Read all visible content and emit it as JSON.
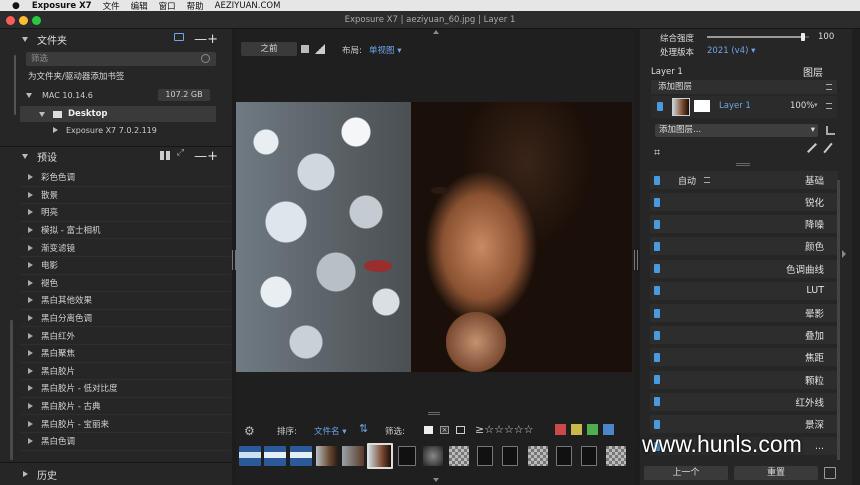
{
  "menubar": {
    "apple": "",
    "app": "Exposure X7",
    "items": [
      "文件",
      "编辑",
      "窗口",
      "帮助",
      "AEZIYUAN.COM"
    ]
  },
  "window": {
    "title": "Exposure X7 | aeziyuan_60.jpg | Layer 1"
  },
  "folders": {
    "title": "文件夹",
    "filter_placeholder": "筛选",
    "add_bookmark": "为文件夹/驱动器添加书签",
    "drive_name": "MAC 10.14.6",
    "drive_size": "107.2 GB",
    "desktop": "Desktop",
    "sub": "Exposure X7 7.0.2.119"
  },
  "presets": {
    "title": "预设",
    "items": [
      "彩色色调",
      "散景",
      "明亮",
      "模拟 - 富士相机",
      "渐变滤镜",
      "电影",
      "褪色",
      "黑白其他效果",
      "黑白分离色调",
      "黑白红外",
      "黑白聚焦",
      "黑白胶片",
      "黑白胶片 - 低对比度",
      "黑白胶片 - 古典",
      "黑白胶片 - 宝丽来",
      "黑白色调"
    ]
  },
  "history": {
    "title": "历史"
  },
  "toolbar": {
    "before": "之前",
    "layout_label": "布局:",
    "layout_value": "单视图"
  },
  "filmstrip": {
    "sort_label": "排序:",
    "sort_value": "文件名",
    "filter_label": "筛选:",
    "rating_prefix": "≥",
    "stars": "☆☆☆☆☆"
  },
  "right": {
    "strength_label": "综合强度",
    "strength_value": "100",
    "strength_level": 0.94,
    "version_label": "处理版本",
    "version_value": "2021 (v4)",
    "layer_label": "Layer 1",
    "layers_title": "图层",
    "add_layer": "添加图层",
    "layer_name": "Layer 1",
    "layer_opacity": "100%",
    "add_layer_select": "添加图层...",
    "auto": "自动",
    "auto_tag": "基础",
    "panels": [
      "锐化",
      "降噪",
      "颜色",
      "色调曲线",
      "LUT",
      "晕影",
      "叠加",
      "焦距",
      "颗粒",
      "红外线",
      "景深",
      "..."
    ],
    "prev_button": "上一个",
    "reset_button": "重置"
  },
  "watermark": "www.hunls.com",
  "colors": {
    "accent": "#4a9ade",
    "label_swatches": [
      "#c94a4a",
      "#c9b84a",
      "#4fae4f",
      "#4a86c9"
    ]
  }
}
